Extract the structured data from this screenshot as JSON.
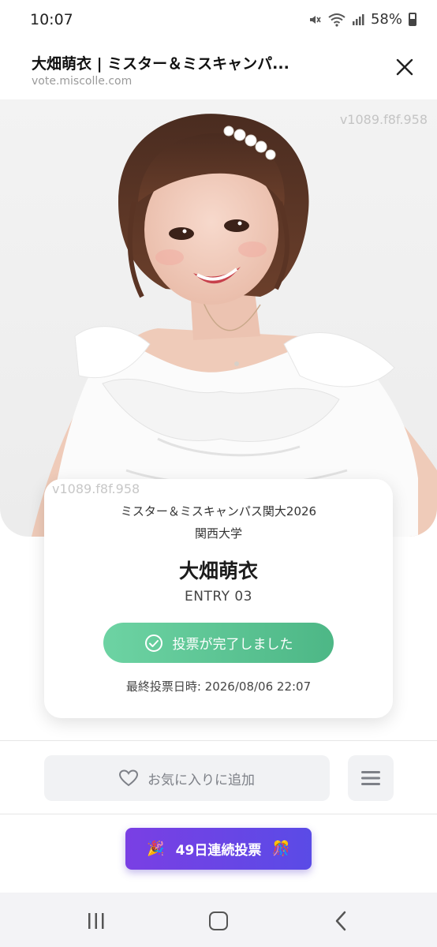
{
  "status_bar": {
    "time": "10:07",
    "battery": "58%",
    "icons": [
      "mute-icon",
      "wifi-icon",
      "signal-icon",
      "battery-icon"
    ]
  },
  "browser": {
    "title": "大畑萌衣 | ミスター＆ミスキャンパ...",
    "url": "vote.miscolle.com"
  },
  "hero": {
    "watermark": "v1089.f8f.958"
  },
  "card": {
    "contest_name": "ミスター＆ミスキャンパス関大2026",
    "university": "関西大学",
    "candidate_name": "大畑萌衣",
    "entry": "ENTRY 03",
    "vote_done_label": "投票が完了しました",
    "last_vote": "最終投票日時: 2026/08/06 22:07"
  },
  "actions": {
    "favorite_label": "お気に入りに追加",
    "streak_label": "49日連続投票",
    "streak_emoji_left": "🎉",
    "streak_emoji_right": "🎊"
  },
  "colors": {
    "vote_done": "#5cc595",
    "streak": "#6a45e5",
    "fav_bg": "#f1f2f4"
  }
}
